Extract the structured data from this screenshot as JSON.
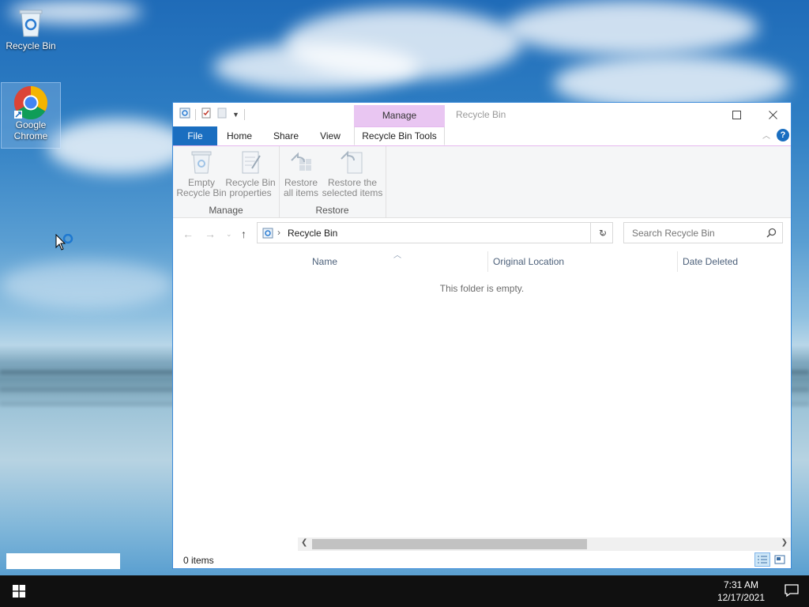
{
  "desktop": {
    "icons": [
      {
        "label": "Recycle Bin"
      },
      {
        "label": "Google Chrome"
      }
    ]
  },
  "window": {
    "title": "Recycle Bin",
    "contextual_tab_group": "Manage",
    "tabs": [
      {
        "label": "File"
      },
      {
        "label": "Home"
      },
      {
        "label": "Share"
      },
      {
        "label": "View"
      },
      {
        "label": "Recycle Bin Tools"
      }
    ],
    "ribbon": {
      "groups": [
        {
          "label": "Manage",
          "buttons": [
            {
              "line1": "Empty",
              "line2": "Recycle Bin"
            },
            {
              "line1": "Recycle Bin",
              "line2": "properties"
            }
          ]
        },
        {
          "label": "Restore",
          "buttons": [
            {
              "line1": "Restore",
              "line2": "all items"
            },
            {
              "line1": "Restore the",
              "line2": "selected items"
            }
          ]
        }
      ]
    },
    "address": {
      "breadcrumb": "Recycle Bin"
    },
    "search": {
      "placeholder": "Search Recycle Bin"
    },
    "columns": [
      {
        "label": "Name"
      },
      {
        "label": "Original Location"
      },
      {
        "label": "Date Deleted"
      }
    ],
    "empty_message": "This folder is empty.",
    "status": {
      "item_count": "0 items"
    }
  },
  "taskbar": {
    "time": "7:31 AM",
    "date": "12/17/2021"
  },
  "colors": {
    "accent": "#1a6ec0",
    "contextual_tab": "#e9c6f2",
    "taskbar": "#101010"
  }
}
